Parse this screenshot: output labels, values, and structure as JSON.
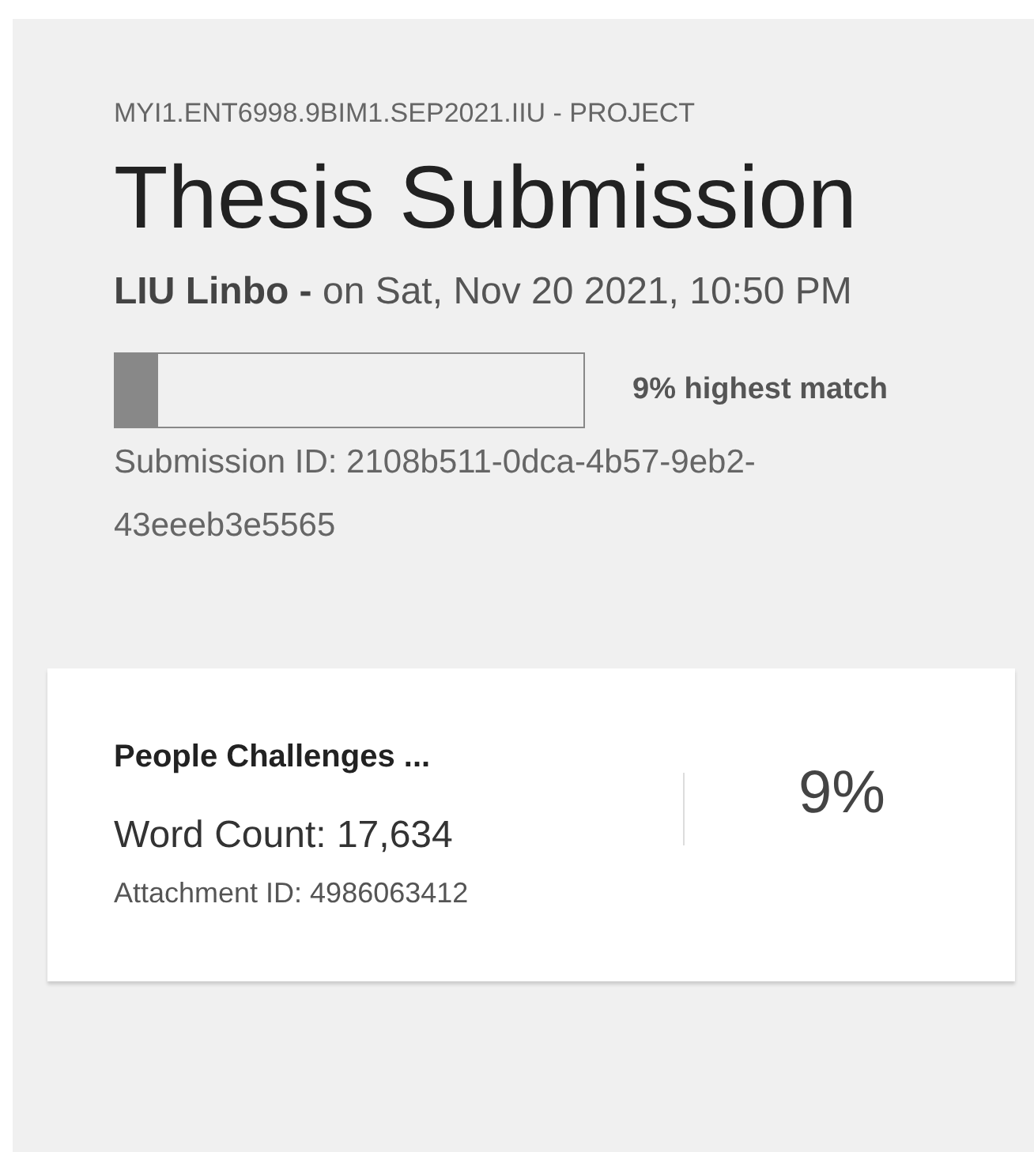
{
  "course": "MYI1.ENT6998.9BIM1.SEP2021.IIU - PROJECT",
  "title": "Thesis Submission",
  "byline": "**LIU Linbo -** on Sat, Nov 20 2021, 10:50 PM",
  "match": {
    "level": 0.09,
    "label": "9% highest match"
  },
  "submission_id": "Submission ID: 2108b511-0dca-4b57-9eb2-43eeeb3e5565",
  "attachment": {
    "name": "People Challenges ...",
    "word_count": "Word Count: 17,634",
    "attachment_id": "Attachment ID: 4986063412",
    "score": "9%"
  }
}
